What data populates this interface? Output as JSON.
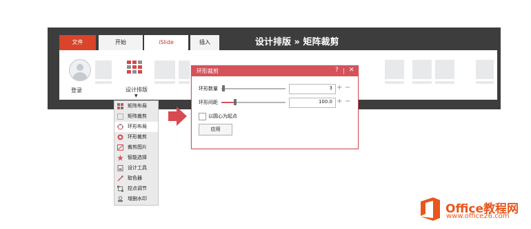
{
  "headline": "设计排版 » 矩阵裁剪",
  "ribbon": {
    "tabs": [
      {
        "label": "文件"
      },
      {
        "label": "开始"
      },
      {
        "label": "iSlide"
      },
      {
        "label": "插入"
      }
    ],
    "login_label": "登录",
    "design_label": "设计排版",
    "design_caret": "▼"
  },
  "dropdown": {
    "items": [
      {
        "label": "矩阵布局",
        "icon": "grid-layout-icon"
      },
      {
        "label": "矩阵裁剪",
        "icon": "grid-crop-icon"
      },
      {
        "label": "环形布局",
        "icon": "ring-layout-icon"
      },
      {
        "label": "环形裁剪",
        "icon": "ring-crop-icon"
      },
      {
        "label": "裁剪图片",
        "icon": "crop-image-icon"
      },
      {
        "label": "智能选择",
        "icon": "smart-select-icon"
      },
      {
        "label": "设计工具",
        "icon": "design-tools-icon"
      },
      {
        "label": "取色器",
        "icon": "color-picker-icon"
      },
      {
        "label": "控点调节",
        "icon": "handle-adjust-icon"
      },
      {
        "label": "增删水印",
        "icon": "watermark-icon"
      }
    ],
    "selected_index": 2
  },
  "dialog": {
    "title": "环形裁剪",
    "help": "?",
    "close": "✕",
    "rows": [
      {
        "label": "环形数量",
        "value": "3",
        "slider_level": 0.02
      },
      {
        "label": "环形间距",
        "value": "100.0",
        "slider_level": 0.2
      }
    ],
    "checkbox_label": "以圆心为起点",
    "checkbox_checked": false,
    "apply_label": "应用"
  },
  "logo": {
    "text": "Office教程网",
    "url": "www.office26.com"
  },
  "colors": {
    "accent": "#d5525a",
    "file_tab": "#d9442a",
    "frame": "#3d3d3d",
    "logo": "#e8561b"
  }
}
